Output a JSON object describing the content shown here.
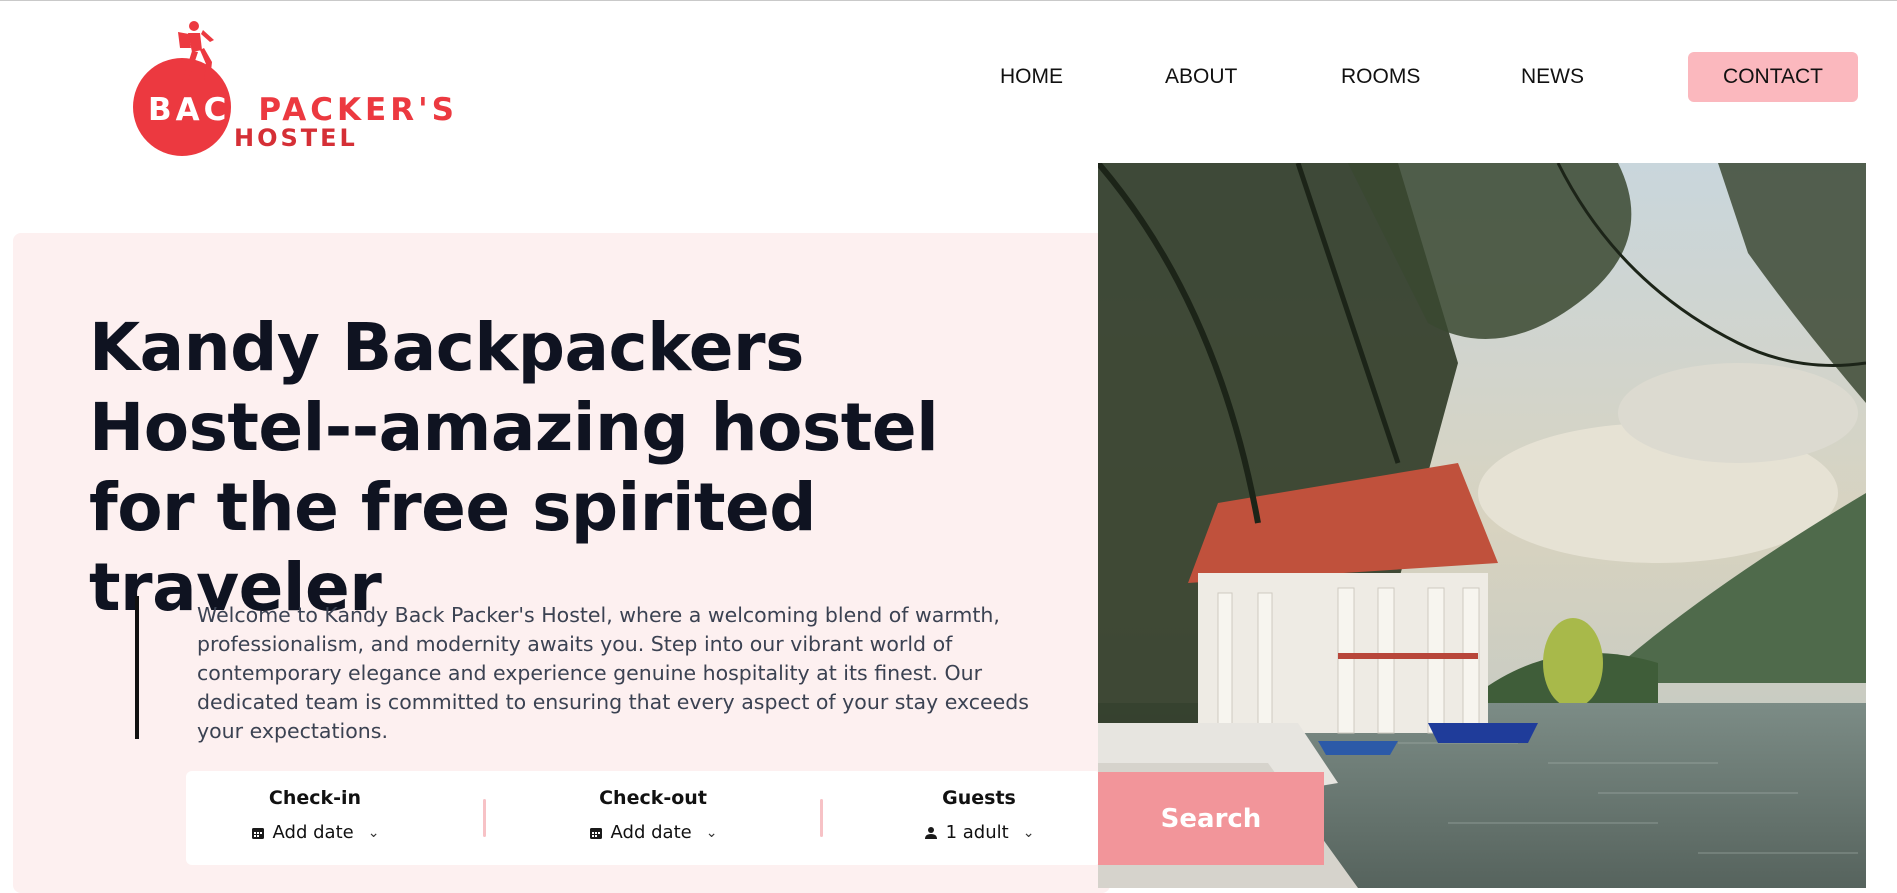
{
  "logo": {
    "line1_white": "BACK",
    "line1_red": "PACKER'S",
    "line2": "HOSTEL"
  },
  "nav": {
    "items": [
      {
        "label": "HOME"
      },
      {
        "label": "ABOUT"
      },
      {
        "label": "ROOMS"
      },
      {
        "label": "NEWS"
      }
    ],
    "contact": "CONTACT"
  },
  "hero": {
    "title": "Kandy Backpackers Hostel--amazing hostel for the free spirited traveler",
    "description": "Welcome to Kandy Back Packer's Hostel, where a welcoming blend of warmth, professionalism, and modernity awaits you. Step into our vibrant world of contemporary elegance and experience genuine hospitality at its finest. Our dedicated team is committed to ensuring that every aspect of your stay exceeds your expectations."
  },
  "booking": {
    "checkin": {
      "label": "Check-in",
      "value": "Add date",
      "icon": "calendar-icon"
    },
    "checkout": {
      "label": "Check-out",
      "value": "Add date",
      "icon": "calendar-icon"
    },
    "guests": {
      "label": "Guests",
      "value": "1 adult",
      "icon": "user-icon"
    },
    "search": "Search"
  },
  "colors": {
    "brand_red": "#ec3940",
    "contact_bg": "#fbb8be",
    "panel_bg": "#fdf0f0",
    "search_bg": "#f2959a",
    "separator": "#f7c2c6"
  }
}
